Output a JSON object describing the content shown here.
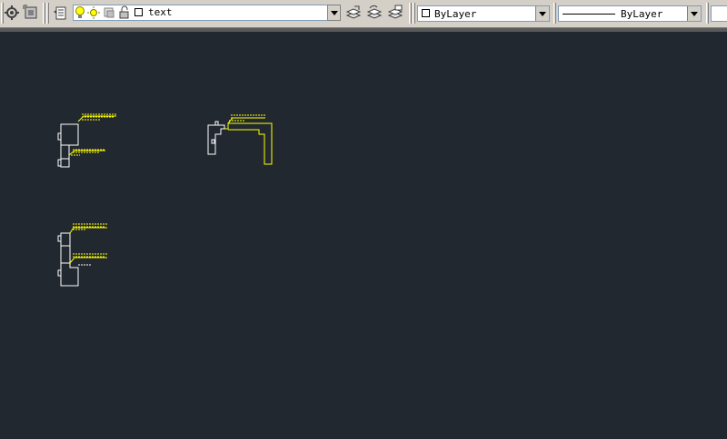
{
  "toolbar": {
    "layer_combo": {
      "value": "text",
      "icons": [
        "lightbulb-icon",
        "sun-icon",
        "freeze-icon",
        "lock-icon",
        "color-square-icon"
      ]
    },
    "color_combo": {
      "value": "ByLayer"
    },
    "linetype_combo": {
      "value": "ByLayer"
    },
    "colors": {
      "face": "#d4d0c8",
      "canvas": "#212830",
      "yellow": "#ffff00",
      "white": "#ffffff"
    }
  }
}
